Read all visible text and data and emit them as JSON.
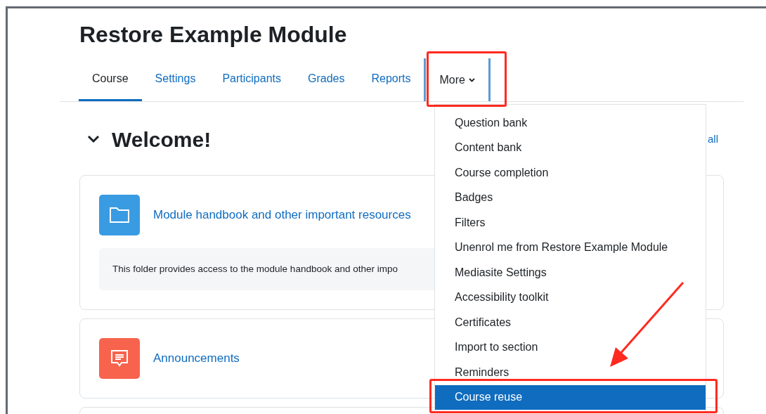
{
  "page": {
    "title": "Restore Example Module"
  },
  "tabs": [
    {
      "label": "Course",
      "selected": true,
      "kind": "link"
    },
    {
      "label": "Settings",
      "selected": false,
      "kind": "link"
    },
    {
      "label": "Participants",
      "selected": false,
      "kind": "link"
    },
    {
      "label": "Grades",
      "selected": false,
      "kind": "link"
    },
    {
      "label": "Reports",
      "selected": false,
      "kind": "link"
    },
    {
      "label": "More",
      "selected": false,
      "kind": "dropdown",
      "expanded": true
    }
  ],
  "section": {
    "title": "Welcome!",
    "expanded": true,
    "collapse_link": "all"
  },
  "activities": [
    {
      "kind": "folder",
      "title": "Module handbook and other important resources",
      "description": "This folder provides access to the module handbook and other impo"
    },
    {
      "kind": "forum",
      "title": "Announcements"
    }
  ],
  "menu": {
    "items": [
      {
        "label": "Question bank",
        "selected": false
      },
      {
        "label": "Content bank",
        "selected": false
      },
      {
        "label": "Course completion",
        "selected": false
      },
      {
        "label": "Badges",
        "selected": false
      },
      {
        "label": "Filters",
        "selected": false
      },
      {
        "label": "Unenrol me from Restore Example Module",
        "selected": false
      },
      {
        "label": "Mediasite Settings",
        "selected": false
      },
      {
        "label": "Accessibility toolkit",
        "selected": false
      },
      {
        "label": "Certificates",
        "selected": false
      },
      {
        "label": "Import to section",
        "selected": false
      },
      {
        "label": "Reminders",
        "selected": false
      },
      {
        "label": "Course reuse",
        "selected": true
      }
    ]
  }
}
